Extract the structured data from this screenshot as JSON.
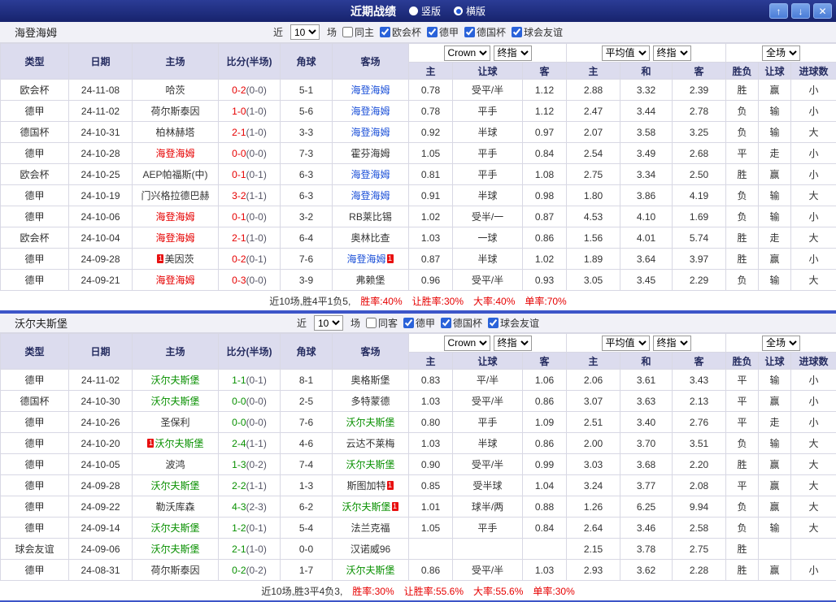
{
  "titlebar": {
    "title": "近期战绩",
    "layout_options": [
      {
        "label": "竖版",
        "selected": false
      },
      {
        "label": "横版",
        "selected": true
      }
    ],
    "buttons": {
      "up": "↑",
      "down": "↓",
      "close": "✕"
    }
  },
  "colors": {
    "titlebar_bg": "#1d2b7a",
    "accent_line": "#3d55c8",
    "header_bg": "#dcdcee",
    "league_uefa_conference": "#bb5fc6",
    "league_bundesliga": "#d4409d",
    "league_pokal": "#9e3f55",
    "league_friendly": "#12b5b5",
    "win_red": "#e60000",
    "draw_blue": "#1b50d8",
    "lose_green": "#089000"
  },
  "sections": [
    {
      "team": "海登海姆",
      "score_color": "red",
      "filter": {
        "prefix": "近",
        "count": "10",
        "suffix": "场",
        "same": {
          "label": "同主",
          "checked": false
        },
        "leagues": [
          {
            "label": "欧会杯",
            "checked": true
          },
          {
            "label": "德甲",
            "checked": true
          },
          {
            "label": "德国杯",
            "checked": true
          },
          {
            "label": "球会友谊",
            "checked": true
          }
        ]
      },
      "columns": {
        "type": "类型",
        "date": "日期",
        "home": "主场",
        "score": "比分(半场)",
        "corner": "角球",
        "away": "客场",
        "asian_selects": [
          "Crown",
          "终指"
        ],
        "asian": [
          "主",
          "让球",
          "客"
        ],
        "euro_selects": [
          "平均值",
          "终指"
        ],
        "euro": [
          "主",
          "和",
          "客"
        ],
        "scope_select": "全场",
        "results": [
          "胜负",
          "让球",
          "进球数"
        ]
      },
      "rows": [
        {
          "lg": "欧会杯",
          "lk": "uefa",
          "date": "24-11-08",
          "home": {
            "n": "哈茨",
            "c": "dark"
          },
          "ft": "0-2",
          "ht": "(0-0)",
          "cn": "5-1",
          "away": {
            "n": "海登海姆",
            "c": "blue"
          },
          "ah": [
            "0.78",
            "受平/半",
            "1.12"
          ],
          "eu": [
            "2.88",
            "3.32",
            "2.39"
          ],
          "res": [
            [
              "胜",
              "red"
            ],
            [
              "赢",
              "red"
            ],
            [
              "小",
              "green"
            ]
          ]
        },
        {
          "lg": "德甲",
          "lk": "bund",
          "date": "24-11-02",
          "home": {
            "n": "荷尔斯泰因",
            "c": "dark"
          },
          "ft": "1-0",
          "ht": "(1-0)",
          "cn": "5-6",
          "away": {
            "n": "海登海姆",
            "c": "blue"
          },
          "ah": [
            "0.78",
            "平手",
            "1.12"
          ],
          "eu": [
            "2.47",
            "3.44",
            "2.78"
          ],
          "res": [
            [
              "负",
              "green"
            ],
            [
              "输",
              "green"
            ],
            [
              "小",
              "green"
            ]
          ]
        },
        {
          "lg": "德国杯",
          "lk": "pokal",
          "date": "24-10-31",
          "home": {
            "n": "柏林赫塔",
            "c": "dark"
          },
          "ft": "2-1",
          "ht": "(1-0)",
          "cn": "3-3",
          "away": {
            "n": "海登海姆",
            "c": "blue"
          },
          "ah": [
            "0.92",
            "半球",
            "0.97"
          ],
          "eu": [
            "2.07",
            "3.58",
            "3.25"
          ],
          "res": [
            [
              "负",
              "green"
            ],
            [
              "输",
              "green"
            ],
            [
              "大",
              "red"
            ]
          ]
        },
        {
          "lg": "德甲",
          "lk": "bund",
          "date": "24-10-28",
          "home": {
            "n": "海登海姆",
            "c": "red"
          },
          "ft": "0-0",
          "ht": "(0-0)",
          "cn": "7-3",
          "away": {
            "n": "霍芬海姆",
            "c": "dark"
          },
          "ah": [
            "1.05",
            "平手",
            "0.84"
          ],
          "eu": [
            "2.54",
            "3.49",
            "2.68"
          ],
          "res": [
            [
              "平",
              "blue"
            ],
            [
              "走",
              "blue"
            ],
            [
              "小",
              "green"
            ]
          ]
        },
        {
          "lg": "欧会杯",
          "lk": "uefa",
          "date": "24-10-25",
          "home": {
            "n": "AEP帕福斯(中)",
            "c": "dark"
          },
          "ft": "0-1",
          "ht": "(0-1)",
          "cn": "6-3",
          "away": {
            "n": "海登海姆",
            "c": "blue"
          },
          "ah": [
            "0.81",
            "平手",
            "1.08"
          ],
          "eu": [
            "2.75",
            "3.34",
            "2.50"
          ],
          "res": [
            [
              "胜",
              "red"
            ],
            [
              "赢",
              "red"
            ],
            [
              "小",
              "green"
            ]
          ]
        },
        {
          "lg": "德甲",
          "lk": "bund",
          "date": "24-10-19",
          "home": {
            "n": "门兴格拉德巴赫",
            "c": "dark"
          },
          "ft": "3-2",
          "ht": "(1-1)",
          "cn": "6-3",
          "away": {
            "n": "海登海姆",
            "c": "blue"
          },
          "ah": [
            "0.91",
            "半球",
            "0.98"
          ],
          "eu": [
            "1.80",
            "3.86",
            "4.19"
          ],
          "res": [
            [
              "负",
              "green"
            ],
            [
              "输",
              "green"
            ],
            [
              "大",
              "red"
            ]
          ]
        },
        {
          "lg": "德甲",
          "lk": "bund",
          "date": "24-10-06",
          "home": {
            "n": "海登海姆",
            "c": "red"
          },
          "ft": "0-1",
          "ht": "(0-0)",
          "cn": "3-2",
          "away": {
            "n": "RB莱比锡",
            "c": "dark"
          },
          "ah": [
            "1.02",
            "受半/一",
            "0.87"
          ],
          "eu": [
            "4.53",
            "4.10",
            "1.69"
          ],
          "res": [
            [
              "负",
              "green"
            ],
            [
              "输",
              "green"
            ],
            [
              "小",
              "green"
            ]
          ]
        },
        {
          "lg": "欧会杯",
          "lk": "uefa",
          "date": "24-10-04",
          "home": {
            "n": "海登海姆",
            "c": "red"
          },
          "ft": "2-1",
          "ht": "(1-0)",
          "cn": "6-4",
          "away": {
            "n": "奥林比查",
            "c": "dark"
          },
          "ah": [
            "1.03",
            "一球",
            "0.86"
          ],
          "eu": [
            "1.56",
            "4.01",
            "5.74"
          ],
          "res": [
            [
              "胜",
              "red"
            ],
            [
              "走",
              "blue"
            ],
            [
              "大",
              "red"
            ]
          ]
        },
        {
          "lg": "德甲",
          "lk": "bund",
          "date": "24-09-28",
          "home": {
            "n": "美因茨",
            "c": "dark",
            "pre": "1"
          },
          "ft": "0-2",
          "ht": "(0-1)",
          "cn": "7-6",
          "away": {
            "n": "海登海姆",
            "c": "blue",
            "post": "1"
          },
          "ah": [
            "0.87",
            "半球",
            "1.02"
          ],
          "eu": [
            "1.89",
            "3.64",
            "3.97"
          ],
          "res": [
            [
              "胜",
              "red"
            ],
            [
              "赢",
              "red"
            ],
            [
              "小",
              "green"
            ]
          ]
        },
        {
          "lg": "德甲",
          "lk": "bund",
          "date": "24-09-21",
          "home": {
            "n": "海登海姆",
            "c": "red"
          },
          "ft": "0-3",
          "ht": "(0-0)",
          "cn": "3-9",
          "away": {
            "n": "弗赖堡",
            "c": "dark"
          },
          "ah": [
            "0.96",
            "受平/半",
            "0.93"
          ],
          "eu": [
            "3.05",
            "3.45",
            "2.29"
          ],
          "res": [
            [
              "负",
              "green"
            ],
            [
              "输",
              "green"
            ],
            [
              "大",
              "red"
            ]
          ]
        }
      ],
      "footer": {
        "summary": "近10场,胜4平1负5,",
        "rates": [
          "胜率:40%",
          "让胜率:30%",
          "大率:40%",
          "单率:70%"
        ]
      }
    },
    {
      "team": "沃尔夫斯堡",
      "score_color": "green",
      "filter": {
        "prefix": "近",
        "count": "10",
        "suffix": "场",
        "same": {
          "label": "同客",
          "checked": false
        },
        "leagues": [
          {
            "label": "德甲",
            "checked": true
          },
          {
            "label": "德国杯",
            "checked": true
          },
          {
            "label": "球会友谊",
            "checked": true
          }
        ]
      },
      "columns": {
        "type": "类型",
        "date": "日期",
        "home": "主场",
        "score": "比分(半场)",
        "corner": "角球",
        "away": "客场",
        "asian_selects": [
          "Crown",
          "终指"
        ],
        "asian": [
          "主",
          "让球",
          "客"
        ],
        "euro_selects": [
          "平均值",
          "终指"
        ],
        "euro": [
          "主",
          "和",
          "客"
        ],
        "scope_select": "全场",
        "results": [
          "胜负",
          "让球",
          "进球数"
        ]
      },
      "rows": [
        {
          "lg": "德甲",
          "lk": "bund",
          "date": "24-11-02",
          "home": {
            "n": "沃尔夫斯堡",
            "c": "green"
          },
          "ft": "1-1",
          "ht": "(0-1)",
          "cn": "8-1",
          "away": {
            "n": "奥格斯堡",
            "c": "dark"
          },
          "ah": [
            "0.83",
            "平/半",
            "1.06"
          ],
          "eu": [
            "2.06",
            "3.61",
            "3.43"
          ],
          "res": [
            [
              "平",
              "blue"
            ],
            [
              "输",
              "green"
            ],
            [
              "小",
              "green"
            ]
          ]
        },
        {
          "lg": "德国杯",
          "lk": "pokal",
          "date": "24-10-30",
          "home": {
            "n": "沃尔夫斯堡",
            "c": "green"
          },
          "ft": "0-0",
          "ht": "(0-0)",
          "cn": "2-5",
          "away": {
            "n": "多特蒙德",
            "c": "dark"
          },
          "ah": [
            "1.03",
            "受平/半",
            "0.86"
          ],
          "eu": [
            "3.07",
            "3.63",
            "2.13"
          ],
          "res": [
            [
              "平",
              "blue"
            ],
            [
              "赢",
              "red"
            ],
            [
              "小",
              "green"
            ]
          ]
        },
        {
          "lg": "德甲",
          "lk": "bund",
          "date": "24-10-26",
          "home": {
            "n": "圣保利",
            "c": "dark"
          },
          "ft": "0-0",
          "ht": "(0-0)",
          "cn": "7-6",
          "away": {
            "n": "沃尔夫斯堡",
            "c": "green"
          },
          "ah": [
            "0.80",
            "平手",
            "1.09"
          ],
          "eu": [
            "2.51",
            "3.40",
            "2.76"
          ],
          "res": [
            [
              "平",
              "blue"
            ],
            [
              "走",
              "blue"
            ],
            [
              "小",
              "green"
            ]
          ]
        },
        {
          "lg": "德甲",
          "lk": "bund",
          "date": "24-10-20",
          "home": {
            "n": "沃尔夫斯堡",
            "c": "green",
            "pre": "1"
          },
          "ft": "2-4",
          "ht": "(1-1)",
          "cn": "4-6",
          "away": {
            "n": "云达不莱梅",
            "c": "dark"
          },
          "ah": [
            "1.03",
            "半球",
            "0.86"
          ],
          "eu": [
            "2.00",
            "3.70",
            "3.51"
          ],
          "res": [
            [
              "负",
              "green"
            ],
            [
              "输",
              "green"
            ],
            [
              "大",
              "red"
            ]
          ]
        },
        {
          "lg": "德甲",
          "lk": "bund",
          "date": "24-10-05",
          "home": {
            "n": "波鸿",
            "c": "dark"
          },
          "ft": "1-3",
          "ht": "(0-2)",
          "cn": "7-4",
          "away": {
            "n": "沃尔夫斯堡",
            "c": "green"
          },
          "ah": [
            "0.90",
            "受平/半",
            "0.99"
          ],
          "eu": [
            "3.03",
            "3.68",
            "2.20"
          ],
          "res": [
            [
              "胜",
              "red"
            ],
            [
              "赢",
              "red"
            ],
            [
              "大",
              "red"
            ]
          ]
        },
        {
          "lg": "德甲",
          "lk": "bund",
          "date": "24-09-28",
          "home": {
            "n": "沃尔夫斯堡",
            "c": "green"
          },
          "ft": "2-2",
          "ht": "(1-1)",
          "cn": "1-3",
          "away": {
            "n": "斯图加特",
            "c": "dark",
            "post": "1"
          },
          "ah": [
            "0.85",
            "受半球",
            "1.04"
          ],
          "eu": [
            "3.24",
            "3.77",
            "2.08"
          ],
          "res": [
            [
              "平",
              "blue"
            ],
            [
              "赢",
              "red"
            ],
            [
              "大",
              "red"
            ]
          ]
        },
        {
          "lg": "德甲",
          "lk": "bund",
          "date": "24-09-22",
          "home": {
            "n": "勒沃库森",
            "c": "dark"
          },
          "ft": "4-3",
          "ht": "(2-3)",
          "cn": "6-2",
          "away": {
            "n": "沃尔夫斯堡",
            "c": "green",
            "post": "1"
          },
          "ah": [
            "1.01",
            "球半/两",
            "0.88"
          ],
          "eu": [
            "1.26",
            "6.25",
            "9.94"
          ],
          "res": [
            [
              "负",
              "green"
            ],
            [
              "赢",
              "red"
            ],
            [
              "大",
              "red"
            ]
          ]
        },
        {
          "lg": "德甲",
          "lk": "bund",
          "date": "24-09-14",
          "home": {
            "n": "沃尔夫斯堡",
            "c": "green"
          },
          "ft": "1-2",
          "ht": "(0-1)",
          "cn": "5-4",
          "away": {
            "n": "法兰克福",
            "c": "dark"
          },
          "ah": [
            "1.05",
            "平手",
            "0.84"
          ],
          "eu": [
            "2.64",
            "3.46",
            "2.58"
          ],
          "res": [
            [
              "负",
              "green"
            ],
            [
              "输",
              "green"
            ],
            [
              "大",
              "red"
            ]
          ]
        },
        {
          "lg": "球会友谊",
          "lk": "fri",
          "date": "24-09-06",
          "home": {
            "n": "沃尔夫斯堡",
            "c": "green"
          },
          "ft": "2-1",
          "ht": "(1-0)",
          "cn": "0-0",
          "away": {
            "n": "汉诺威96",
            "c": "dark"
          },
          "ah": [
            "",
            "",
            ""
          ],
          "eu": [
            "2.15",
            "3.78",
            "2.75"
          ],
          "res": [
            [
              "胜",
              "red"
            ],
            [
              "",
              ""
            ],
            [
              "",
              ""
            ]
          ]
        },
        {
          "lg": "德甲",
          "lk": "bund",
          "date": "24-08-31",
          "home": {
            "n": "荷尔斯泰因",
            "c": "dark"
          },
          "ft": "0-2",
          "ht": "(0-2)",
          "cn": "1-7",
          "away": {
            "n": "沃尔夫斯堡",
            "c": "green"
          },
          "ah": [
            "0.86",
            "受平/半",
            "1.03"
          ],
          "eu": [
            "2.93",
            "3.62",
            "2.28"
          ],
          "res": [
            [
              "胜",
              "red"
            ],
            [
              "赢",
              "red"
            ],
            [
              "小",
              "green"
            ]
          ]
        }
      ],
      "footer": {
        "summary": "近10场,胜3平4负3,",
        "rates": [
          "胜率:30%",
          "让胜率:55.6%",
          "大率:55.6%",
          "单率:30%"
        ]
      }
    }
  ]
}
